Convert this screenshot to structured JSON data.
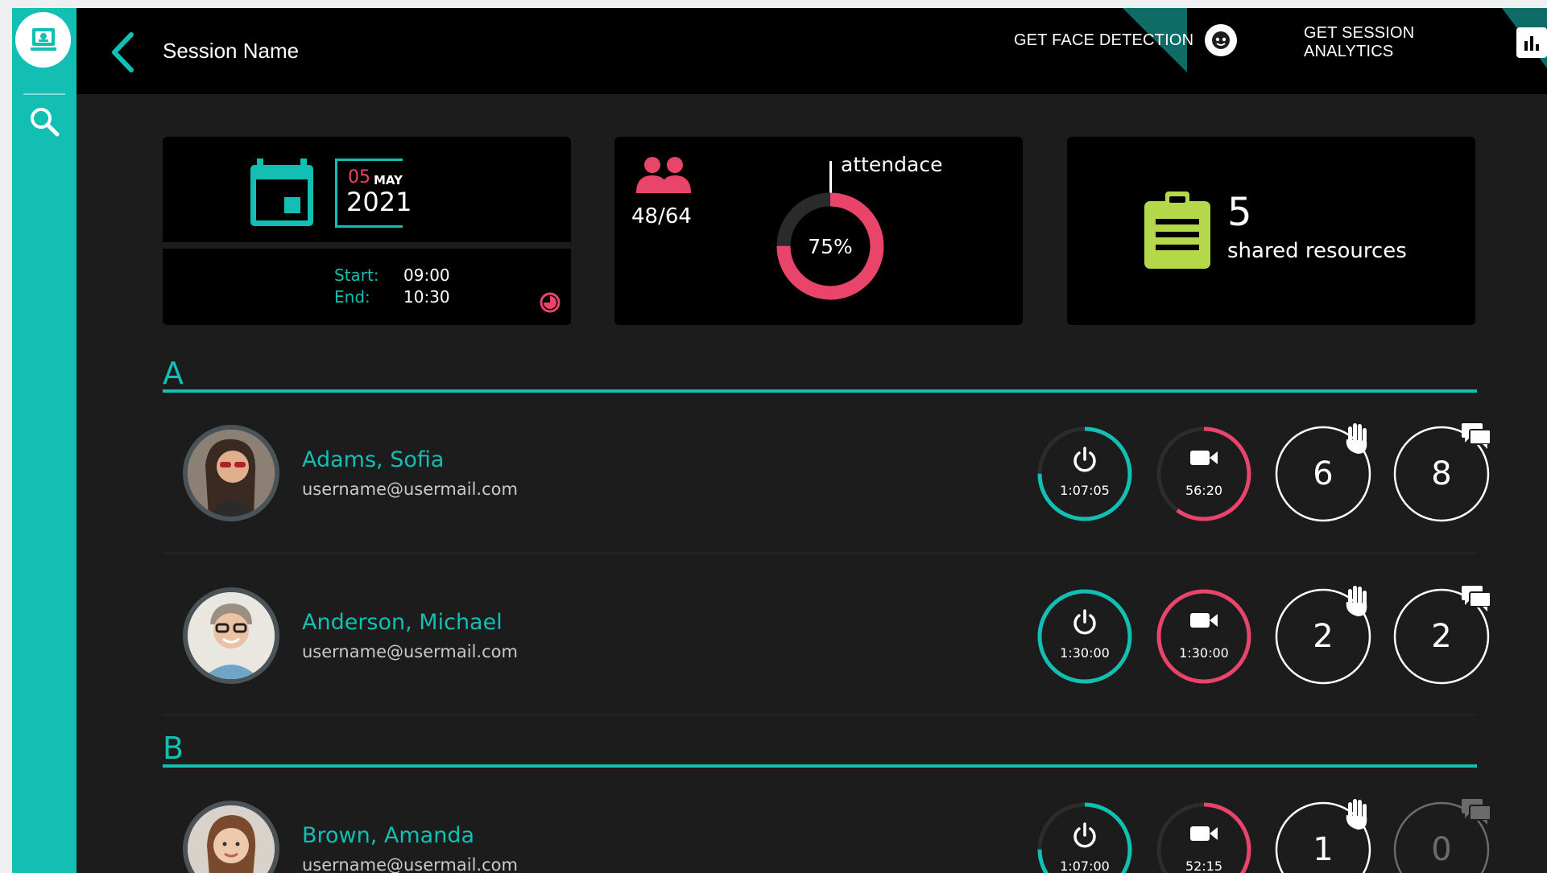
{
  "header": {
    "title": "Session Name",
    "face_detection_label": "GET FACE DETECTION",
    "analytics_label": "GET SESSION ANALYTICS"
  },
  "date_card": {
    "day": "05",
    "month": "MAY",
    "year": "2021",
    "start_label": "Start:",
    "start_time": "09:00",
    "end_label": "End:",
    "end_time": "10:30"
  },
  "attendance_card": {
    "count": "48/64",
    "label": "attendace",
    "percent_text": "75%",
    "percent": 75
  },
  "resources_card": {
    "count": "5",
    "label": "shared resources"
  },
  "colors": {
    "teal": "#13bfb2",
    "pink": "#e9446a",
    "green": "#b4d84a"
  },
  "sections": [
    {
      "letter": "A",
      "students": [
        {
          "name": "Adams, Sofia",
          "email": "username@usermail.com",
          "online_time": "1:07:05",
          "online_fraction": 0.75,
          "video_time": "56:20",
          "video_fraction": 0.6,
          "hands": "6",
          "chats": "8"
        },
        {
          "name": "Anderson, Michael",
          "email": "username@usermail.com",
          "online_time": "1:30:00",
          "online_fraction": 1.0,
          "video_time": "1:30:00",
          "video_fraction": 1.0,
          "hands": "2",
          "chats": "2"
        }
      ]
    },
    {
      "letter": "B",
      "students": [
        {
          "name": "Brown, Amanda",
          "email": "username@usermail.com",
          "online_time": "1:07:00",
          "online_fraction": 0.75,
          "video_time": "52:15",
          "video_fraction": 0.58,
          "hands": "1",
          "chats": "0"
        }
      ]
    }
  ]
}
